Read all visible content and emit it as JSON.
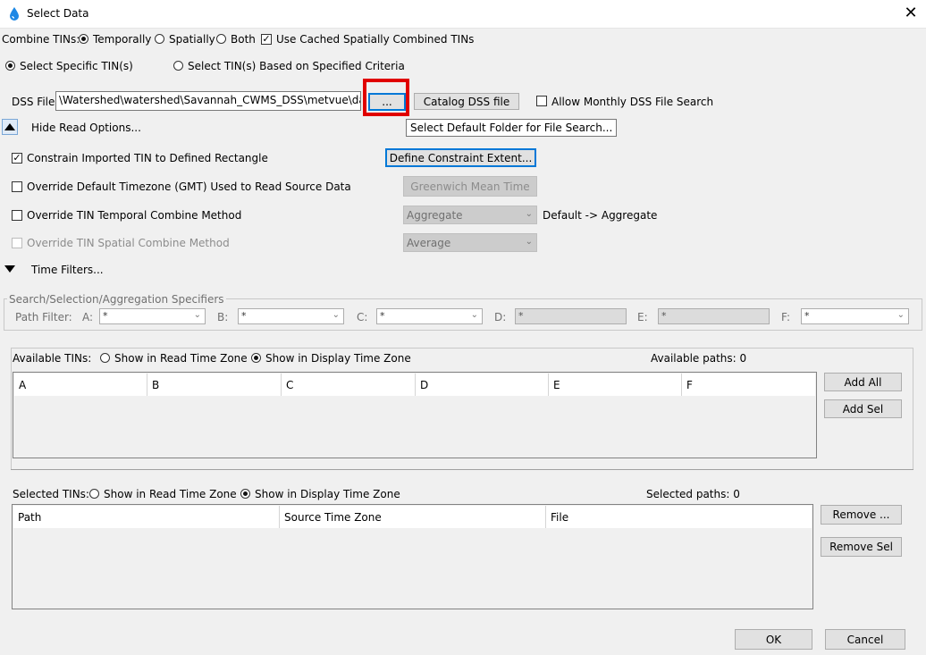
{
  "window": {
    "title": "Select Data",
    "close_label": "✕",
    "icon": "water-drop-icon"
  },
  "combine": {
    "label": "Combine TINs:",
    "temporally": "Temporally",
    "spatially": "Spatially",
    "both": "Both",
    "selected": "Temporally",
    "use_cached": "Use Cached Spatially Combined TINs",
    "use_cached_checked": true
  },
  "selection_mode": {
    "specific": "Select Specific TIN(s)",
    "criteria": "Select TIN(s) Based on Specified Criteria",
    "selected": "specific"
  },
  "dss": {
    "label": "DSS File:",
    "path": "\\Watershed\\watershed\\Savannah_CWMS_DSS\\metvue\\data.dss",
    "browse_label": "...",
    "catalog_label": "Catalog DSS file",
    "monthly_label": "Allow Monthly DSS File Search",
    "monthly_checked": false,
    "tooltip": "Select Default Folder for File Search..."
  },
  "read_options": {
    "toggle_label": "Hide Read Options...",
    "constrain_label": "Constrain Imported TIN to Defined Rectangle",
    "constrain_checked": true,
    "define_extent_label": "Define Constraint Extent...",
    "timezone_label": "Override Default Timezone (GMT) Used to Read Source Data",
    "timezone_checked": false,
    "timezone_button": "Greenwich Mean Time",
    "temporal_label": "Override TIN Temporal Combine Method",
    "temporal_checked": false,
    "temporal_value": "Aggregate",
    "temporal_default": "Default -> Aggregate",
    "spatial_label": "Override TIN Spatial Combine Method",
    "spatial_checked": false,
    "spatial_value": "Average"
  },
  "time_filters": {
    "label": "Time Filters..."
  },
  "specifiers": {
    "legend": "Search/Selection/Aggregation Specifiers",
    "path_filter": "Path Filter:",
    "parts": [
      {
        "label": "A:",
        "value": "*",
        "type": "combo"
      },
      {
        "label": "B:",
        "value": "*",
        "type": "combo"
      },
      {
        "label": "C:",
        "value": "*",
        "type": "combo"
      },
      {
        "label": "D:",
        "value": "*",
        "type": "field"
      },
      {
        "label": "E:",
        "value": "*",
        "type": "field"
      },
      {
        "label": "F:",
        "value": "*",
        "type": "combo"
      }
    ]
  },
  "available": {
    "label": "Available TINs:",
    "read_tz": "Show in Read Time Zone",
    "display_tz": "Show in Display Time Zone",
    "selected_tz": "display",
    "count_label": "Available paths: 0",
    "columns": [
      "A",
      "B",
      "C",
      "D",
      "E",
      "F"
    ],
    "add_all": "Add All",
    "add_sel": "Add Sel"
  },
  "selected": {
    "label": "Selected TINs:",
    "read_tz": "Show in Read Time Zone",
    "display_tz": "Show in Display Time Zone",
    "selected_tz": "display",
    "count_label": "Selected paths: 0",
    "columns": [
      "Path",
      "Source Time Zone",
      "File"
    ],
    "remove": "Remove ...",
    "remove_sel": "Remove Sel"
  },
  "footer": {
    "ok": "OK",
    "cancel": "Cancel"
  },
  "colors": {
    "highlight": "#e00000",
    "focus": "#0078d7"
  }
}
